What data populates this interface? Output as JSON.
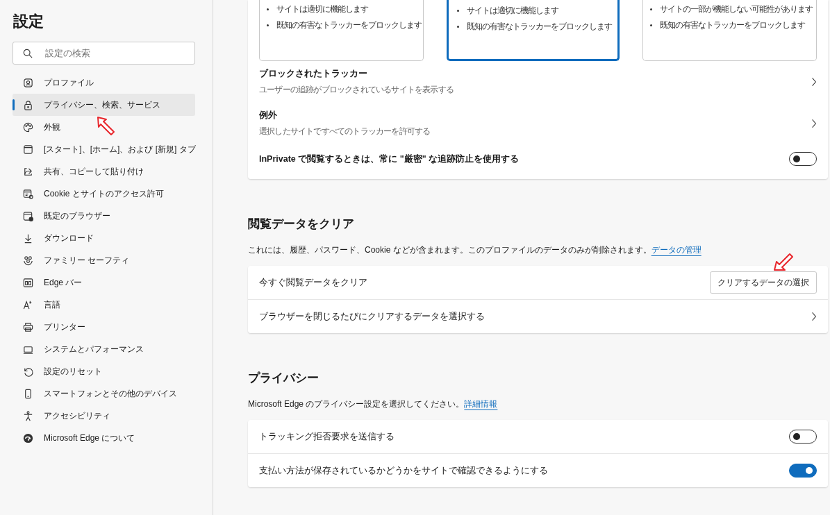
{
  "sidebar": {
    "title": "設定",
    "search": {
      "placeholder": "設定の検索"
    },
    "items": [
      {
        "label": "プロファイル",
        "selected": false
      },
      {
        "label": "プライバシー、検索、サービス",
        "selected": true
      },
      {
        "label": "外観",
        "selected": false
      },
      {
        "label": "[スタート]、[ホーム]、および [新規] タブ",
        "selected": false
      },
      {
        "label": "共有、コピーして貼り付け",
        "selected": false
      },
      {
        "label": "Cookie とサイトのアクセス許可",
        "selected": false
      },
      {
        "label": "既定のブラウザー",
        "selected": false
      },
      {
        "label": "ダウンロード",
        "selected": false
      },
      {
        "label": "ファミリー セーフティ",
        "selected": false
      },
      {
        "label": "Edge バー",
        "selected": false
      },
      {
        "label": "言語",
        "selected": false
      },
      {
        "label": "プリンター",
        "selected": false
      },
      {
        "label": "システムとパフォーマンス",
        "selected": false
      },
      {
        "label": "設定のリセット",
        "selected": false
      },
      {
        "label": "スマートフォンとその他のデバイス",
        "selected": false
      },
      {
        "label": "アクセシビリティ",
        "selected": false
      },
      {
        "label": "Microsoft Edge について",
        "selected": false
      }
    ]
  },
  "tracking_prevention": {
    "options": [
      {
        "selected": false,
        "bullets": [
          "サイトは適切に機能します",
          "既知の有害なトラッカーをブロックします"
        ]
      },
      {
        "selected": true,
        "bullets": [
          "サイトは適切に機能します",
          "既知の有害なトラッカーをブロックします"
        ]
      },
      {
        "selected": false,
        "bullets": [
          "サイトの一部が機能しない可能性があります",
          "既知の有害なトラッカーをブロックします"
        ]
      }
    ],
    "rows": [
      {
        "kind": "link",
        "title": "ブロックされたトラッカー",
        "subtitle": "ユーザーの追跡がブロックされているサイトを表示する"
      },
      {
        "kind": "link",
        "title": "例外",
        "subtitle": "選択したサイトですべてのトラッカーを許可する"
      },
      {
        "kind": "toggle",
        "title": "InPrivate で閲覧するときは、常に \"厳密\" な追跡防止を使用する",
        "on": false
      }
    ]
  },
  "clear_browsing_data": {
    "heading": "閲覧データをクリア",
    "description": "これには、履歴、パスワード、Cookie などが含まれます。このプロファイルのデータのみが削除されます。",
    "link": "データの管理",
    "rows": [
      {
        "kind": "button",
        "title": "今すぐ閲覧データをクリア",
        "button": "クリアするデータの選択"
      },
      {
        "kind": "link",
        "title": "ブラウザーを閉じるたびにクリアするデータを選択する"
      }
    ]
  },
  "privacy": {
    "heading": "プライバシー",
    "description": "Microsoft Edge のプライバシー設定を選択してください。",
    "link": "詳細情報",
    "rows": [
      {
        "kind": "toggle",
        "title": "トラッキング拒否要求を送信する",
        "on": false
      },
      {
        "kind": "toggle",
        "title": "支払い方法が保存されているかどうかをサイトで確認できるようにする",
        "on": true
      }
    ]
  }
}
